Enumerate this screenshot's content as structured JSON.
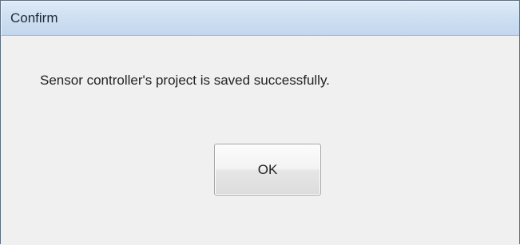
{
  "window": {
    "title": "Confirm"
  },
  "dialog": {
    "message": "Sensor controller's project is saved successfully.",
    "ok_label": "OK"
  }
}
